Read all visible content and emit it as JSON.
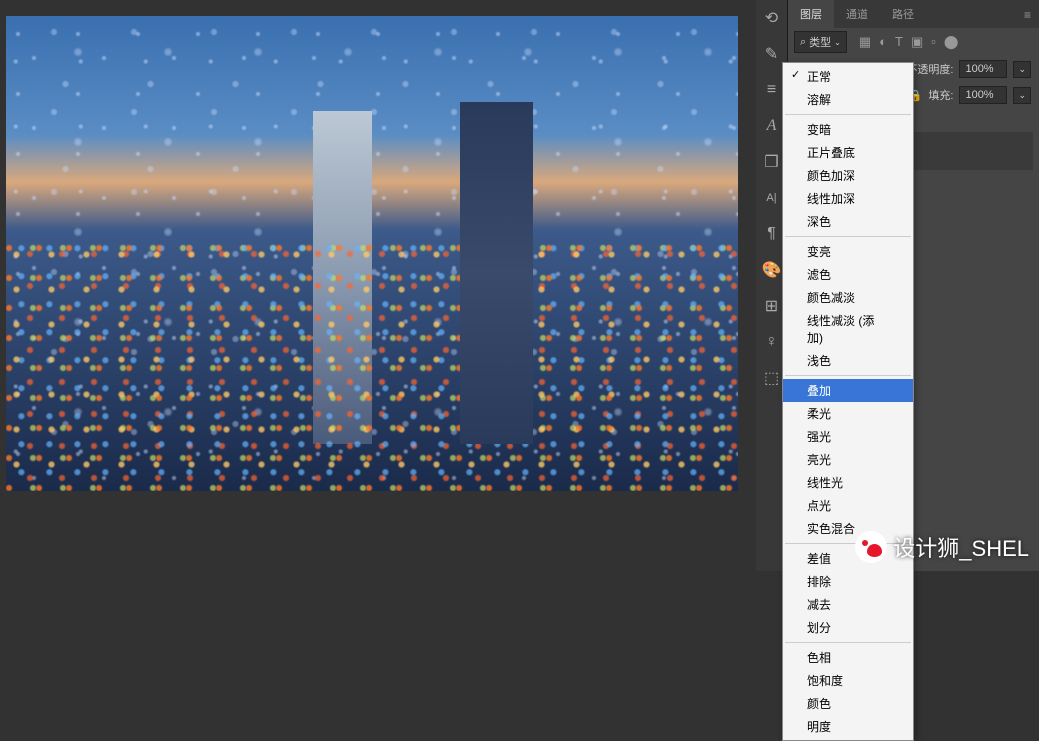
{
  "panel": {
    "tabs": {
      "layers": "图层",
      "channels": "通道",
      "paths": "路径"
    },
    "filter": {
      "kind_label": "类型"
    },
    "props": {
      "opacity_label": "不透明度:",
      "opacity_value": "100%",
      "fill_label": "填充:",
      "fill_value": "100%"
    }
  },
  "vertical_tools": {
    "history": "history-icon",
    "brush": "brush-icon",
    "adjustments": "adjustments-icon",
    "type": "type-icon",
    "cube": "cube-icon",
    "align": "align-icon",
    "para": "paragraph-icon",
    "swatches": "swatches-icon",
    "grid": "grid-icon",
    "lightbulb": "lightbulb-icon",
    "box3d": "box3d-icon"
  },
  "blend_modes": {
    "group1": [
      {
        "label": "正常",
        "checked": true
      },
      {
        "label": "溶解"
      }
    ],
    "group2": [
      {
        "label": "变暗"
      },
      {
        "label": "正片叠底"
      },
      {
        "label": "颜色加深"
      },
      {
        "label": "线性加深"
      },
      {
        "label": "深色"
      }
    ],
    "group3": [
      {
        "label": "变亮"
      },
      {
        "label": "滤色"
      },
      {
        "label": "颜色减淡"
      },
      {
        "label": "线性减淡 (添加)"
      },
      {
        "label": "浅色"
      }
    ],
    "group4": [
      {
        "label": "叠加",
        "selected": true
      },
      {
        "label": "柔光"
      },
      {
        "label": "强光"
      },
      {
        "label": "亮光"
      },
      {
        "label": "线性光"
      },
      {
        "label": "点光"
      },
      {
        "label": "实色混合"
      }
    ],
    "group5": [
      {
        "label": "差值"
      },
      {
        "label": "排除"
      },
      {
        "label": "减去"
      },
      {
        "label": "划分"
      }
    ],
    "group6": [
      {
        "label": "色相"
      },
      {
        "label": "饱和度"
      },
      {
        "label": "颜色"
      },
      {
        "label": "明度"
      }
    ]
  },
  "watermark": {
    "text": "设计狮_SHEL"
  }
}
